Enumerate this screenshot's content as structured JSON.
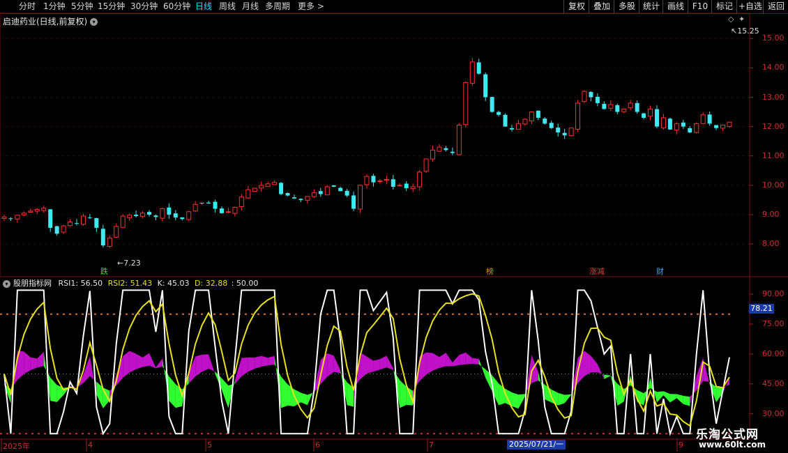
{
  "periods": [
    {
      "label": "分时",
      "selected": false
    },
    {
      "label": "1分钟",
      "selected": false
    },
    {
      "label": "5分钟",
      "selected": false
    },
    {
      "label": "15分钟",
      "selected": false
    },
    {
      "label": "30分钟",
      "selected": false
    },
    {
      "label": "60分钟",
      "selected": false
    },
    {
      "label": "日线",
      "selected": true
    },
    {
      "label": "周线",
      "selected": false
    },
    {
      "label": "月线",
      "selected": false
    },
    {
      "label": "多周期",
      "selected": false
    },
    {
      "label": "更多",
      "selected": false
    }
  ],
  "right_buttons": [
    "复权",
    "叠加",
    "多股",
    "统计",
    "画线",
    "F10",
    "标记",
    "+自选",
    "返回"
  ],
  "chart_title": "启迪药业(日线,前复权)",
  "price_axis": [
    "15.00",
    "14.00",
    "13.00",
    "12.00",
    "11.00",
    "10.00",
    "9.00",
    "8.00"
  ],
  "price_high_label": "15.25",
  "price_low_label": "7.23",
  "event_tags": [
    {
      "text": "跌",
      "color": "#30e030"
    },
    {
      "text": "榜",
      "color": "#e08a20"
    },
    {
      "text": "涨减",
      "color": "#e04040"
    },
    {
      "text": "财",
      "color": "#4aa0ff"
    }
  ],
  "indicator": {
    "name": "股朋指标网",
    "rsi1_label": "RSI1: 56.50",
    "rsi2_label": "RSI2: 51.43",
    "k_label": "K: 45.03",
    "d_label": "D: 32.88",
    "extra_label": ": 50.00",
    "axis": [
      "90.00",
      "75.00",
      "60.00",
      "45.00",
      "30.00"
    ],
    "current_value": "78.21"
  },
  "date_axis": {
    "labels": [
      "2025年",
      "4",
      "5",
      "6",
      "7",
      "9"
    ],
    "cursor_date": "2025/07/21/一"
  },
  "watermark": {
    "line1": "乐淘公式网",
    "line2": "www.60lt.com"
  },
  "colors": {
    "up": "#ff3030",
    "down": "#40e8f0",
    "rsi1_fill": "#c010c8",
    "rsi2_fill": "#30ff30",
    "k_line": "#ffffff",
    "d_line": "#e8e020"
  },
  "chart_data": {
    "type": "candlestick",
    "price_ylim": [
      7.1,
      15.6
    ],
    "indicator_ylim": [
      18,
      96
    ],
    "candles_close": [
      8.92,
      8.85,
      8.98,
      9.05,
      9.12,
      9.18,
      9.22,
      8.55,
      8.35,
      8.62,
      8.75,
      8.7,
      8.95,
      8.9,
      8.55,
      7.95,
      8.2,
      8.6,
      8.95,
      8.98,
      8.95,
      9.05,
      9.0,
      8.92,
      9.2,
      9.0,
      8.9,
      8.85,
      9.1,
      9.35,
      9.4,
      9.38,
      9.2,
      9.05,
      9.1,
      9.25,
      9.6,
      9.85,
      9.9,
      10.0,
      10.05,
      10.1,
      9.7,
      9.65,
      9.55,
      9.5,
      9.62,
      9.75,
      9.7,
      9.95,
      9.95,
      9.8,
      9.65,
      9.2,
      10.0,
      10.3,
      10.1,
      10.15,
      10.2,
      9.95,
      10.0,
      9.9,
      9.95,
      10.45,
      10.9,
      11.2,
      11.3,
      11.2,
      11.1,
      12.05,
      13.5,
      14.2,
      13.8,
      13.0,
      12.5,
      12.4,
      12.0,
      11.9,
      12.1,
      12.25,
      12.5,
      12.3,
      12.1,
      11.95,
      11.8,
      11.7,
      11.95,
      12.8,
      13.2,
      13.0,
      12.8,
      12.6,
      12.75,
      12.5,
      12.6,
      12.8,
      12.5,
      12.3,
      12.6,
      12.0,
      12.3,
      11.9,
      12.1,
      12.0,
      11.8,
      12.1,
      12.4,
      12.1,
      11.95,
      12.05,
      12.15
    ]
  }
}
